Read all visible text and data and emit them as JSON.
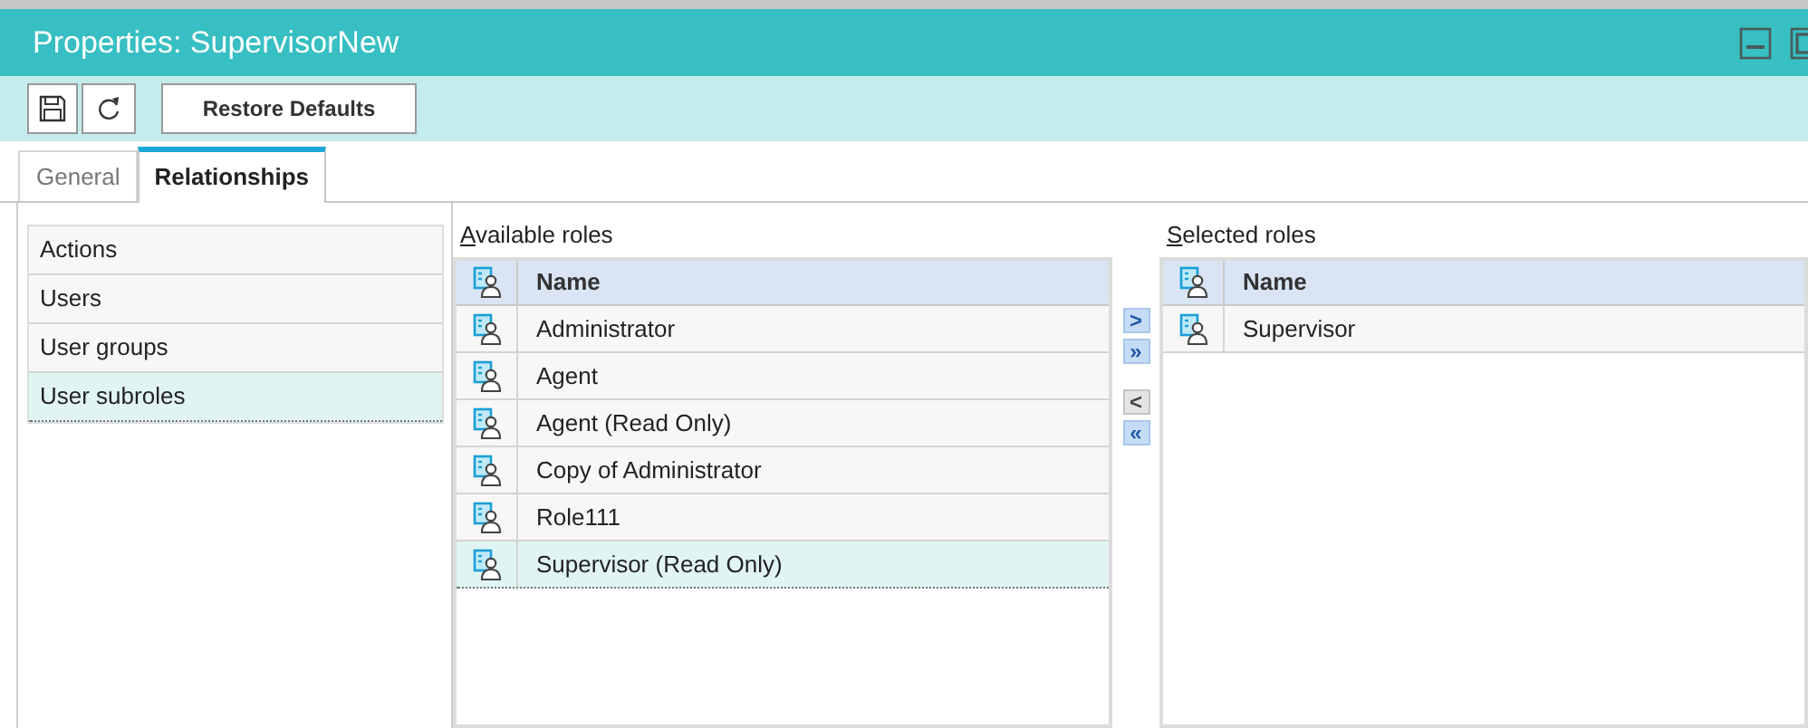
{
  "window": {
    "title": "Properties: SupervisorNew"
  },
  "toolbar": {
    "restore_button": "Restore Defaults"
  },
  "tabs": [
    {
      "label": "General",
      "selected": false
    },
    {
      "label": "Relationships",
      "selected": true
    }
  ],
  "sidebar": {
    "items": [
      {
        "label": "Actions",
        "selected": false
      },
      {
        "label": "Users",
        "selected": false
      },
      {
        "label": "User groups",
        "selected": false
      },
      {
        "label": "User subroles",
        "selected": true
      }
    ]
  },
  "available_roles": {
    "label": "Available roles",
    "column": "Name",
    "rows": [
      {
        "name": "Administrator",
        "selected": false
      },
      {
        "name": "Agent",
        "selected": false
      },
      {
        "name": "Agent (Read Only)",
        "selected": false
      },
      {
        "name": "Copy of Administrator",
        "selected": false
      },
      {
        "name": "Role111",
        "selected": false
      },
      {
        "name": "Supervisor (Read Only)",
        "selected": true
      }
    ]
  },
  "transfer_buttons": [
    {
      "glyph": ">",
      "enabled": true
    },
    {
      "glyph": "»",
      "enabled": true
    },
    {
      "glyph": "<",
      "enabled": false
    },
    {
      "glyph": "«",
      "enabled": true
    }
  ],
  "selected_roles": {
    "label": "Selected roles",
    "column": "Name",
    "rows": [
      {
        "name": "Supervisor",
        "selected": false
      }
    ]
  }
}
